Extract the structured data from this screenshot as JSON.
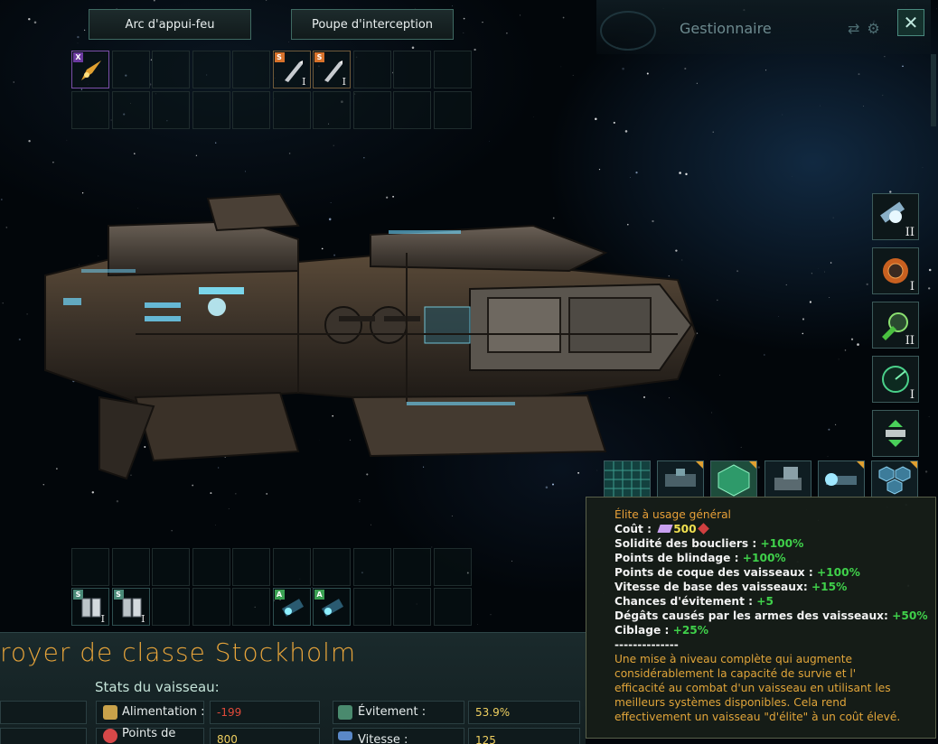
{
  "header": {
    "tab_left": "Arc d'appui-feu",
    "tab_right": "Poupe d'interception",
    "manager_title": "Gestionnaire"
  },
  "slots_top": {
    "row1": [
      {
        "tag": "X",
        "level": "",
        "icon": "spinal-mount-weapon-icon",
        "filled": true
      },
      {
        "tag": "",
        "level": "",
        "icon": "",
        "filled": false
      },
      {
        "tag": "",
        "level": "",
        "icon": "",
        "filled": false
      },
      {
        "tag": "",
        "level": "",
        "icon": "",
        "filled": false
      },
      {
        "tag": "",
        "level": "",
        "icon": "",
        "filled": false
      },
      {
        "tag": "S",
        "level": "I",
        "icon": "missile-icon",
        "filled": true
      },
      {
        "tag": "S",
        "level": "I",
        "icon": "missile-icon",
        "filled": true
      },
      {
        "tag": "",
        "level": "",
        "icon": "",
        "filled": false
      },
      {
        "tag": "",
        "level": "",
        "icon": "",
        "filled": false
      },
      {
        "tag": "",
        "level": "",
        "icon": "",
        "filled": false
      }
    ]
  },
  "slots_bottom": {
    "row2": [
      {
        "tag": "S",
        "level": "I",
        "icon": "armor-plate-icon"
      },
      {
        "tag": "S",
        "level": "I",
        "icon": "armor-plate-icon"
      },
      {
        "tag": "",
        "level": "",
        "icon": ""
      },
      {
        "tag": "",
        "level": "",
        "icon": ""
      },
      {
        "tag": "",
        "level": "",
        "icon": ""
      },
      {
        "tag": "A",
        "level": "",
        "icon": "shield-emitter-icon"
      },
      {
        "tag": "A",
        "level": "",
        "icon": "shield-emitter-icon"
      },
      {
        "tag": "",
        "level": "",
        "icon": ""
      },
      {
        "tag": "",
        "level": "",
        "icon": ""
      },
      {
        "tag": "",
        "level": "",
        "icon": ""
      }
    ]
  },
  "components": [
    {
      "icon": "reactor-icon",
      "level": "II"
    },
    {
      "icon": "thruster-icon",
      "level": "I"
    },
    {
      "icon": "ftl-drive-icon",
      "level": "II"
    },
    {
      "icon": "sensor-radar-icon",
      "level": "I"
    },
    {
      "icon": "combat-computer-icon",
      "level": ""
    }
  ],
  "ship": {
    "name": "royer de classe Stockholm",
    "stats_title": "Stats du vaisseau:"
  },
  "stats": {
    "power_label": "Alimentation :",
    "power_value": "-199",
    "hull_label": "Points de",
    "hull_value": "800",
    "evasion_label": "Évitement :",
    "evasion_value": "53.9%",
    "speed_label": "Vitesse :",
    "speed_value": "125"
  },
  "tooltip": {
    "title": "Élite à usage général",
    "cost_label": "Coût :",
    "cost_value": "500",
    "lines": [
      {
        "key": "Solidité des boucliers :",
        "value": "+100%"
      },
      {
        "key": "Points de blindage :",
        "value": "+100%"
      },
      {
        "key": "Points de coque des vaisseaux :",
        "value": "+100%"
      },
      {
        "key": "Vitesse de base des vaisseaux:",
        "value": "+15%"
      },
      {
        "key": "Chances d'évitement :",
        "value": "+5"
      },
      {
        "key": "Dégâts causés par les armes des vaisseaux:",
        "value": "+50%"
      },
      {
        "key": "Ciblage :",
        "value": "+25%"
      }
    ],
    "separator": "--------------",
    "description": [
      "Une mise à niveau complète qui augmente",
      "considérablement la capacité de survie et l'",
      "efficacité au combat d'un vaisseau en utilisant les",
      "meilleurs systèmes disponibles. Cela rend",
      "effectivement un vaisseau \"d'élite\" à un coût élevé."
    ]
  },
  "colors": {
    "accent_orange": "#e7a43a",
    "positive_green": "#3fd04a",
    "negative_red": "#e04a3a",
    "value_yellow": "#f0d060"
  }
}
